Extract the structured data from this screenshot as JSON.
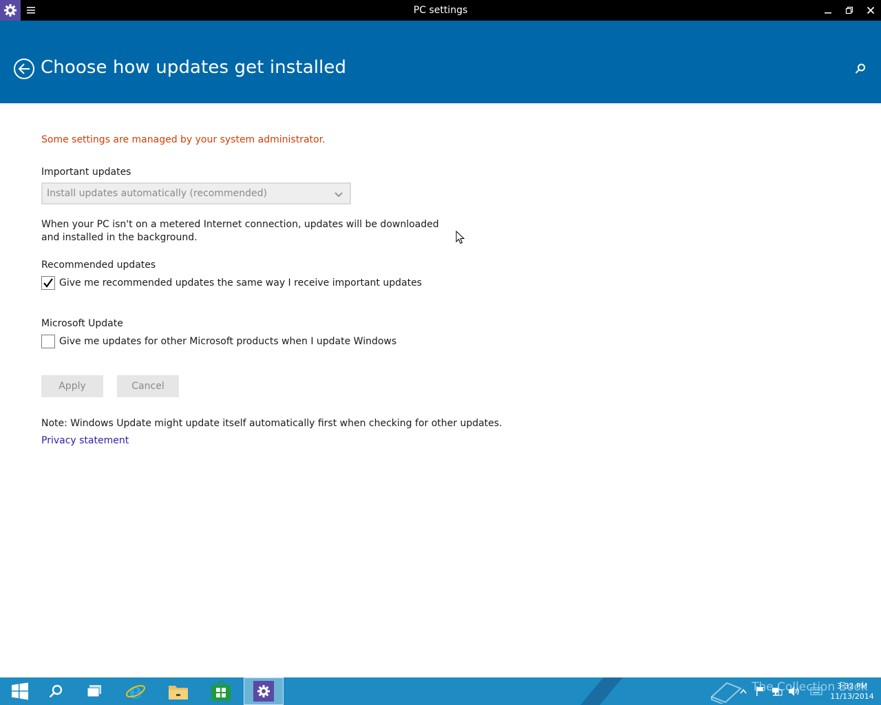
{
  "window": {
    "title": "PC settings"
  },
  "header": {
    "page_title": "Choose how updates get installed"
  },
  "content": {
    "admin_warning": "Some settings are managed by your system administrator.",
    "important_updates": {
      "label": "Important updates",
      "selected_option": "Install updates automatically (recommended)",
      "description": "When your PC isn't on a metered Internet connection, updates will be downloaded and installed in the background."
    },
    "recommended_updates": {
      "label": "Recommended updates",
      "checkbox_label": "Give me recommended updates the same way I receive important updates",
      "checked": true
    },
    "microsoft_update": {
      "label": "Microsoft Update",
      "checkbox_label": "Give me updates for other Microsoft products when I update Windows",
      "checked": false
    },
    "buttons": {
      "apply": "Apply",
      "cancel": "Cancel"
    },
    "note": "Note: Windows Update might update itself automatically first when checking for other updates.",
    "privacy_link": "Privacy statement"
  },
  "taskbar": {
    "watermark": "The Collection Book",
    "clock_time": "3:32 PM",
    "clock_date": "11/13/2014"
  },
  "colors": {
    "header_blue": "#0068a8",
    "warning_orange": "#d83b01",
    "link_blue": "#2a1fa8",
    "taskbar_blue": "#1e8bc3",
    "app_icon_purple": "#5b4aa3"
  },
  "icons": {
    "app": "gear-icon",
    "menu": "hamburger-icon",
    "back": "back-arrow-icon",
    "search": "search-icon"
  }
}
